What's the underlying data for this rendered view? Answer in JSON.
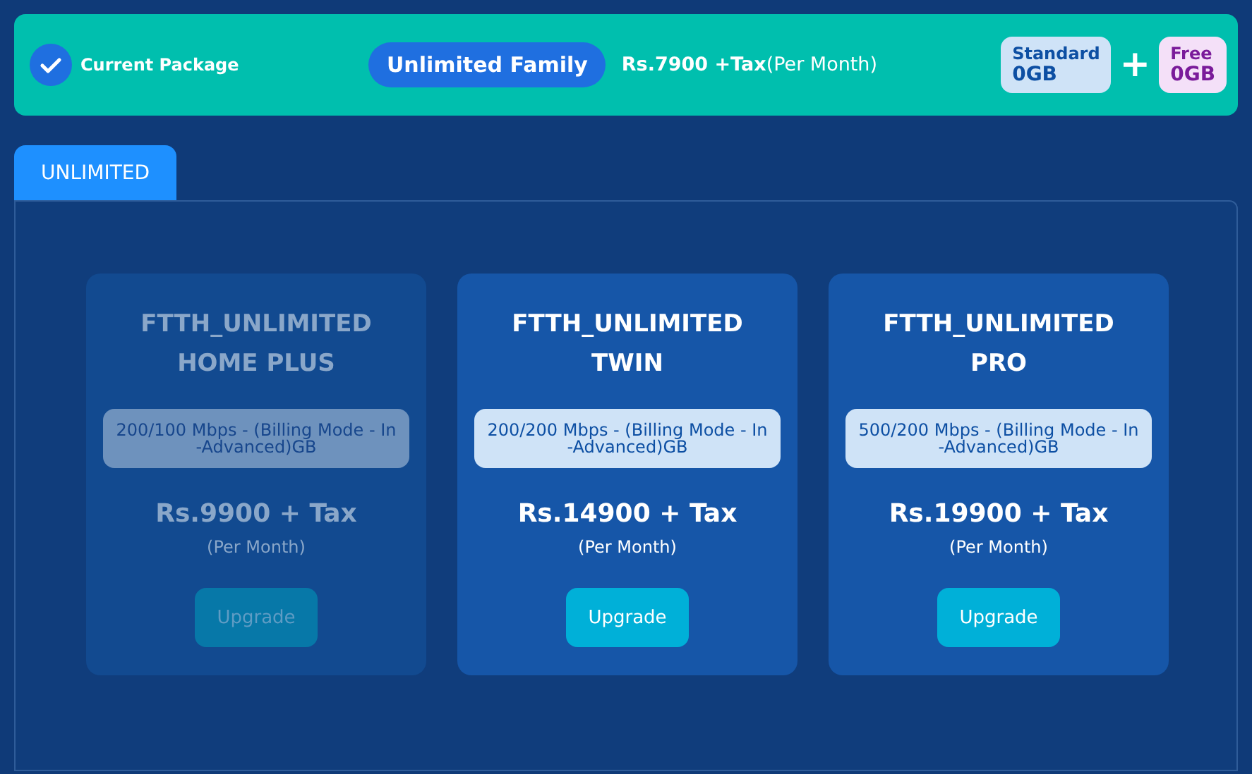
{
  "current_package": {
    "label": "Current Package",
    "checked": true,
    "name": "Unlimited Family",
    "price": "**Rs.7900 +Tax**(Per Month)",
    "quotas": [
      {
        "kind": "standard",
        "label": "Standard",
        "value": "0GB"
      },
      {
        "kind": "free",
        "label": "Free",
        "value": "0GB"
      }
    ],
    "plus": "+"
  },
  "tabs": [
    {
      "label": "UNLIMITED",
      "selected": true
    }
  ],
  "plans": [
    {
      "title": "FTTH_UNLIMITED HOME PLUS",
      "speed": "200/100 Mbps - (Billing Mode - In -Advanced)GB",
      "price": "Rs.9900 + Tax",
      "period": "(Per Month)",
      "button": "Upgrade",
      "disabled": true
    },
    {
      "title": "FTTH_UNLIMITED TWIN",
      "speed": "200/200 Mbps - (Billing Mode - In -Advanced)GB",
      "price": "Rs.14900 + Tax",
      "period": "(Per Month)",
      "button": "Upgrade",
      "disabled": false
    },
    {
      "title": "FTTH_UNLIMITED PRO",
      "speed": "500/200 Mbps - (Billing Mode - In -Advanced)GB",
      "price": "Rs.19900 + Tax",
      "period": "(Per Month)",
      "button": "Upgrade",
      "disabled": false
    }
  ]
}
